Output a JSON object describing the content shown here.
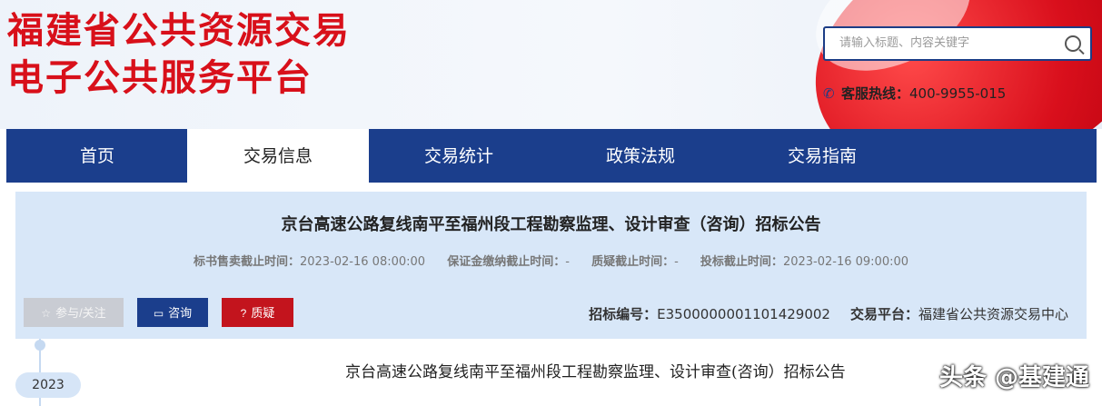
{
  "header": {
    "logo_line1": "福建省公共资源交易",
    "logo_line2": "电子公共服务平台",
    "search_placeholder": "请输入标题、内容关键字",
    "hotline_label": "客服热线：",
    "hotline_number": "400-9955-015"
  },
  "nav": {
    "items": [
      "首页",
      "交易信息",
      "交易统计",
      "政策法规",
      "交易指南"
    ],
    "active_index": 1
  },
  "notice": {
    "title": "京台高速公路复线南平至福州段工程勘察监理、设计审查（咨询）招标公告",
    "meta": [
      {
        "label": "标书售卖截止时间：",
        "value": "2023-02-16 08:00:00"
      },
      {
        "label": "保证金缴纳截止时间：",
        "value": "-"
      },
      {
        "label": "质疑截止时间：",
        "value": "-"
      },
      {
        "label": "投标截止时间：",
        "value": "2023-02-16 09:00:00"
      }
    ],
    "buttons": {
      "follow": "参与/关注",
      "consult": "咨询",
      "query": "质疑"
    },
    "bid_no_label": "招标编号：",
    "bid_no": "E3500000001101429002",
    "platform_label": "交易平台：",
    "platform": "福建省公共资源交易中心"
  },
  "timeline": {
    "year": "2023"
  },
  "content": {
    "subtitle": "京台高速公路复线南平至福州段工程勘察监理、设计审查(咨询）招标公告"
  },
  "watermark": "头条 @基建通",
  "colors": {
    "brand_red": "#d8101a",
    "nav_blue": "#1b3e8c",
    "panel_bg": "#d8e7f8"
  }
}
